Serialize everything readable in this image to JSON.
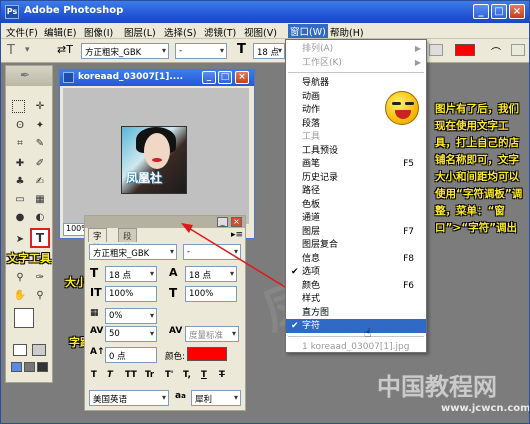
{
  "app": {
    "title": "Adobe Photoshop",
    "logo_text": "Ps"
  },
  "window_buttons": {
    "min": "_",
    "max": "□",
    "close": "×"
  },
  "menubar": {
    "items": [
      "文件(F)",
      "编辑(E)",
      "图像(I)",
      "图层(L)",
      "选择(S)",
      "滤镜(T)",
      "视图(V)",
      "窗口(W)",
      "帮助(H)"
    ],
    "active_index": 7
  },
  "options_bar": {
    "tool_icon": "T",
    "orient_icon": "⇄T",
    "font_family": "方正粗宋_GBK",
    "font_style": "-",
    "size_icon": "T",
    "font_size": "18 点",
    "color_hex": "#ff0000"
  },
  "window_menu": {
    "items": [
      {
        "label": "排列(A)",
        "disabled": true,
        "submenu": true
      },
      {
        "label": "工作区(K)",
        "disabled": true,
        "submenu": true
      },
      {
        "sep": true
      },
      {
        "label": "导航器"
      },
      {
        "label": "动画"
      },
      {
        "label": "动作"
      },
      {
        "label": "段落"
      },
      {
        "label": "工具",
        "disabled": true
      },
      {
        "label": "工具预设"
      },
      {
        "label": "画笔",
        "shortcut": "F5"
      },
      {
        "label": "历史记录"
      },
      {
        "label": "路径"
      },
      {
        "label": "色板"
      },
      {
        "label": "通道"
      },
      {
        "label": "图层",
        "shortcut": "F7"
      },
      {
        "label": "图层复合"
      },
      {
        "label": "信息",
        "shortcut": "F8"
      },
      {
        "label": "选项",
        "checked": true
      },
      {
        "label": "颜色",
        "shortcut": "F6"
      },
      {
        "label": "样式"
      },
      {
        "label": "直方图"
      },
      {
        "label": "字符",
        "checked": true,
        "highlighted": true
      },
      {
        "sep": true
      },
      {
        "label": "1 koreaad_03007[1].jpg",
        "disabled": true
      }
    ]
  },
  "document": {
    "title": "koreaad_03007[1]....",
    "image_text": "凤凰社",
    "zoom": "100%"
  },
  "char_panel": {
    "tab_active": "字符",
    "tab_inactive": "段落",
    "font_family": "方正粗宋_GBK",
    "font_style": "-",
    "font_size": "18 点",
    "leading": "18 点",
    "vscale": "100%",
    "hscale": "100%",
    "kerning": "0%",
    "tracking": "50",
    "kerning_mode": "度量标准",
    "baseline": "0 点",
    "color_label": "颜色:",
    "color_hex": "#ff0000",
    "style_buttons": [
      "T",
      "T",
      "TT",
      "Tr",
      "T'",
      "T,",
      "T",
      "T"
    ],
    "language": "美国英语",
    "aa_label": "a",
    "aa_mode": "犀利"
  },
  "annotations": {
    "text_tool": "文字工具",
    "size": "大小",
    "spacing": "字距"
  },
  "note": "图片有了后，我们现在使用文字工具，打上自己的店铺名称即可，文字大小和间距均可以使用“字符调板”调整，菜单：“窗口”>“字符”调出",
  "watermark": {
    "main": "中国教程网",
    "sub": "www.jcwcn.com",
    "bg": "凤凰社"
  },
  "icons": [
    "photoshop-logo-icon",
    "text-tool-icon",
    "marquee-tool-icon",
    "move-tool-icon",
    "lasso-tool-icon",
    "magic-wand-icon",
    "crop-tool-icon",
    "slice-tool-icon",
    "healing-brush-icon",
    "brush-tool-icon",
    "stamp-tool-icon",
    "history-brush-icon",
    "eraser-icon",
    "gradient-icon",
    "blur-icon",
    "dodge-icon",
    "path-select-icon",
    "pen-icon",
    "notes-icon",
    "eyedropper-icon",
    "hand-icon",
    "zoom-icon",
    "smiley-icon",
    "checkmark-icon"
  ]
}
